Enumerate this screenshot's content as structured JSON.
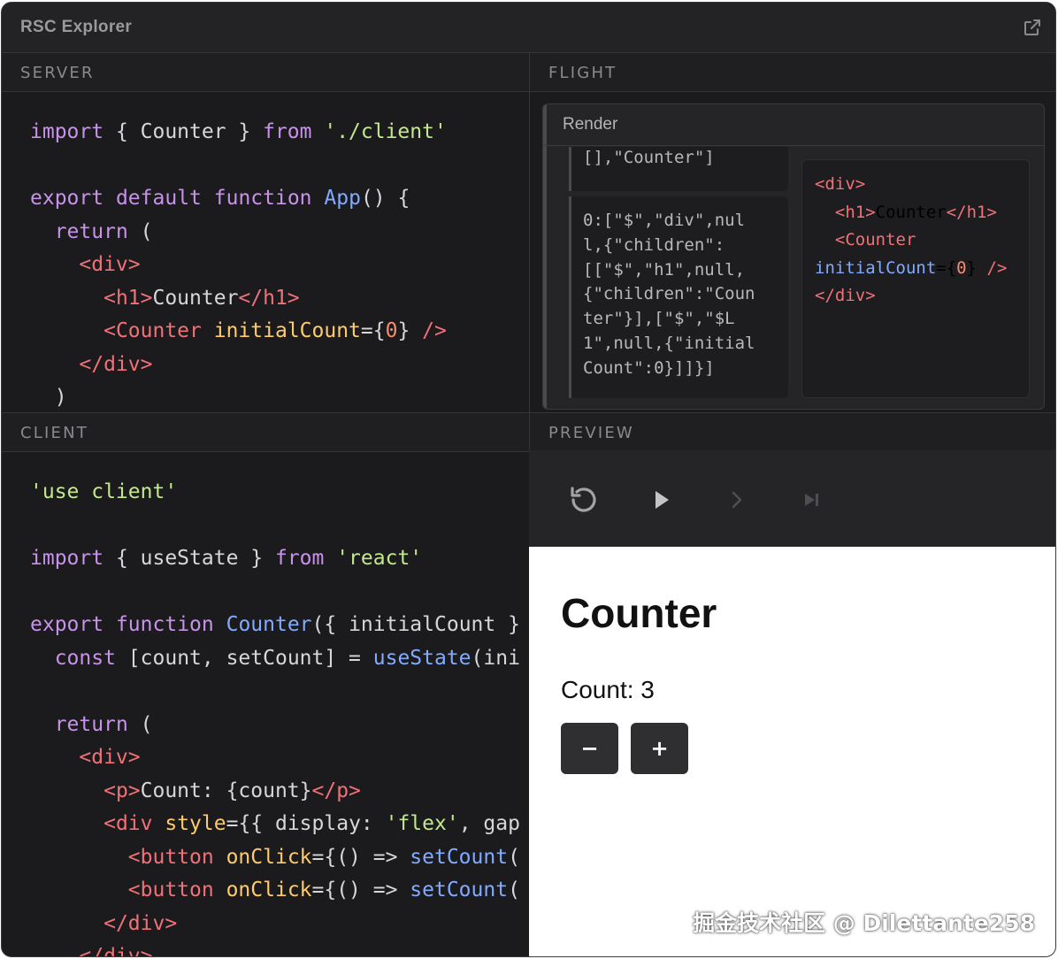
{
  "app": {
    "title": "RSC Explorer"
  },
  "panes": {
    "server": "SERVER",
    "flight": "FLIGHT",
    "client": "CLIENT",
    "preview": "PREVIEW"
  },
  "server_code": [
    [
      {
        "t": "import",
        "c": "kw"
      },
      {
        "t": " { Counter } ",
        "c": ""
      },
      {
        "t": "from",
        "c": "kw"
      },
      {
        "t": " './client'",
        "c": "str"
      }
    ],
    [],
    [
      {
        "t": "export",
        "c": "kw"
      },
      {
        "t": " ",
        "c": ""
      },
      {
        "t": "default",
        "c": "kw"
      },
      {
        "t": " ",
        "c": ""
      },
      {
        "t": "function",
        "c": "kw"
      },
      {
        "t": " ",
        "c": ""
      },
      {
        "t": "App",
        "c": "fn"
      },
      {
        "t": "() {",
        "c": ""
      }
    ],
    [
      {
        "t": "  ",
        "c": ""
      },
      {
        "t": "return",
        "c": "kw"
      },
      {
        "t": " (",
        "c": ""
      }
    ],
    [
      {
        "t": "    ",
        "c": ""
      },
      {
        "t": "<div>",
        "c": "tag"
      }
    ],
    [
      {
        "t": "      ",
        "c": ""
      },
      {
        "t": "<h1>",
        "c": "tag"
      },
      {
        "t": "Counter",
        "c": ""
      },
      {
        "t": "</h1>",
        "c": "tag"
      }
    ],
    [
      {
        "t": "      ",
        "c": ""
      },
      {
        "t": "<Counter",
        "c": "tag"
      },
      {
        "t": " ",
        "c": ""
      },
      {
        "t": "initialCount",
        "c": "attr"
      },
      {
        "t": "={",
        "c": ""
      },
      {
        "t": "0",
        "c": "num"
      },
      {
        "t": "} ",
        "c": ""
      },
      {
        "t": "/>",
        "c": "tag"
      }
    ],
    [
      {
        "t": "    ",
        "c": ""
      },
      {
        "t": "</div>",
        "c": "tag"
      }
    ],
    [
      {
        "t": "  )",
        "c": ""
      }
    ]
  ],
  "client_code": [
    [
      {
        "t": "'use client'",
        "c": "str"
      }
    ],
    [],
    [
      {
        "t": "import",
        "c": "kw"
      },
      {
        "t": " { useState } ",
        "c": ""
      },
      {
        "t": "from",
        "c": "kw"
      },
      {
        "t": " 'react'",
        "c": "str"
      }
    ],
    [],
    [
      {
        "t": "export",
        "c": "kw"
      },
      {
        "t": " ",
        "c": ""
      },
      {
        "t": "function",
        "c": "kw"
      },
      {
        "t": " ",
        "c": ""
      },
      {
        "t": "Counter",
        "c": "fn"
      },
      {
        "t": "({ initialCount }",
        "c": ""
      }
    ],
    [
      {
        "t": "  ",
        "c": ""
      },
      {
        "t": "const",
        "c": "kw"
      },
      {
        "t": " [count, setCount] = ",
        "c": ""
      },
      {
        "t": "useState",
        "c": "fn"
      },
      {
        "t": "(ini",
        "c": ""
      }
    ],
    [],
    [
      {
        "t": "  ",
        "c": ""
      },
      {
        "t": "return",
        "c": "kw"
      },
      {
        "t": " (",
        "c": ""
      }
    ],
    [
      {
        "t": "    ",
        "c": ""
      },
      {
        "t": "<div>",
        "c": "tag"
      }
    ],
    [
      {
        "t": "      ",
        "c": ""
      },
      {
        "t": "<p>",
        "c": "tag"
      },
      {
        "t": "Count: {count}",
        "c": ""
      },
      {
        "t": "</p>",
        "c": "tag"
      }
    ],
    [
      {
        "t": "      ",
        "c": ""
      },
      {
        "t": "<div",
        "c": "tag"
      },
      {
        "t": " ",
        "c": ""
      },
      {
        "t": "style",
        "c": "attr"
      },
      {
        "t": "={{ display: ",
        "c": ""
      },
      {
        "t": "'flex'",
        "c": "str"
      },
      {
        "t": ", gap",
        "c": ""
      }
    ],
    [
      {
        "t": "        ",
        "c": ""
      },
      {
        "t": "<button",
        "c": "tag"
      },
      {
        "t": " ",
        "c": ""
      },
      {
        "t": "onClick",
        "c": "attr"
      },
      {
        "t": "={() => ",
        "c": ""
      },
      {
        "t": "setCount",
        "c": "fn"
      },
      {
        "t": "(",
        "c": ""
      }
    ],
    [
      {
        "t": "        ",
        "c": ""
      },
      {
        "t": "<button",
        "c": "tag"
      },
      {
        "t": " ",
        "c": ""
      },
      {
        "t": "onClick",
        "c": "attr"
      },
      {
        "t": "={() => ",
        "c": ""
      },
      {
        "t": "setCount",
        "c": "fn"
      },
      {
        "t": "(",
        "c": ""
      }
    ],
    [
      {
        "t": "      ",
        "c": ""
      },
      {
        "t": "</div>",
        "c": "tag"
      }
    ],
    [
      {
        "t": "    ",
        "c": ""
      },
      {
        "t": "</div>",
        "c": "tag"
      }
    ]
  ],
  "flight": {
    "render_title": "Render",
    "chunk_prev": "[],\"Counter\"]",
    "chunk_main": [
      "0:[\"$\",\"div\",nul",
      "l,{\"children\":",
      "[[\"$\",\"h1\",null,",
      "{\"children\":\"Coun",
      "ter\"}],[\"$\",\"$L",
      "1\",null,{\"initial",
      "Count\":0}]]}]"
    ],
    "tree": [
      [
        {
          "t": "<div>",
          "c": "tag"
        }
      ],
      [
        {
          "t": "  ",
          "c": ""
        },
        {
          "t": "<h1>",
          "c": "tag"
        },
        {
          "t": "Counter",
          "c": ""
        },
        {
          "t": "</h1>",
          "c": "tag"
        }
      ],
      [
        {
          "t": "  ",
          "c": ""
        },
        {
          "t": "<Counter",
          "c": "tag"
        }
      ],
      [
        {
          "t": "initialCount",
          "c": "fn"
        },
        {
          "t": "={",
          "c": ""
        },
        {
          "t": "0",
          "c": "num"
        },
        {
          "t": "} ",
          "c": ""
        },
        {
          "t": "/>",
          "c": "tag"
        }
      ],
      [
        {
          "t": "</div>",
          "c": "tag"
        }
      ]
    ]
  },
  "preview": {
    "heading": "Counter",
    "count_text": "Count: 3",
    "minus_label": "−",
    "plus_label": "+"
  },
  "watermark": "掘金技术社区 @ Dilettante258",
  "colors": {
    "keyword": "#c792ea",
    "string": "#c3e88d",
    "function": "#82aaff",
    "tag": "#f07178",
    "attribute": "#ffcb6b",
    "number": "#f78c6c"
  }
}
